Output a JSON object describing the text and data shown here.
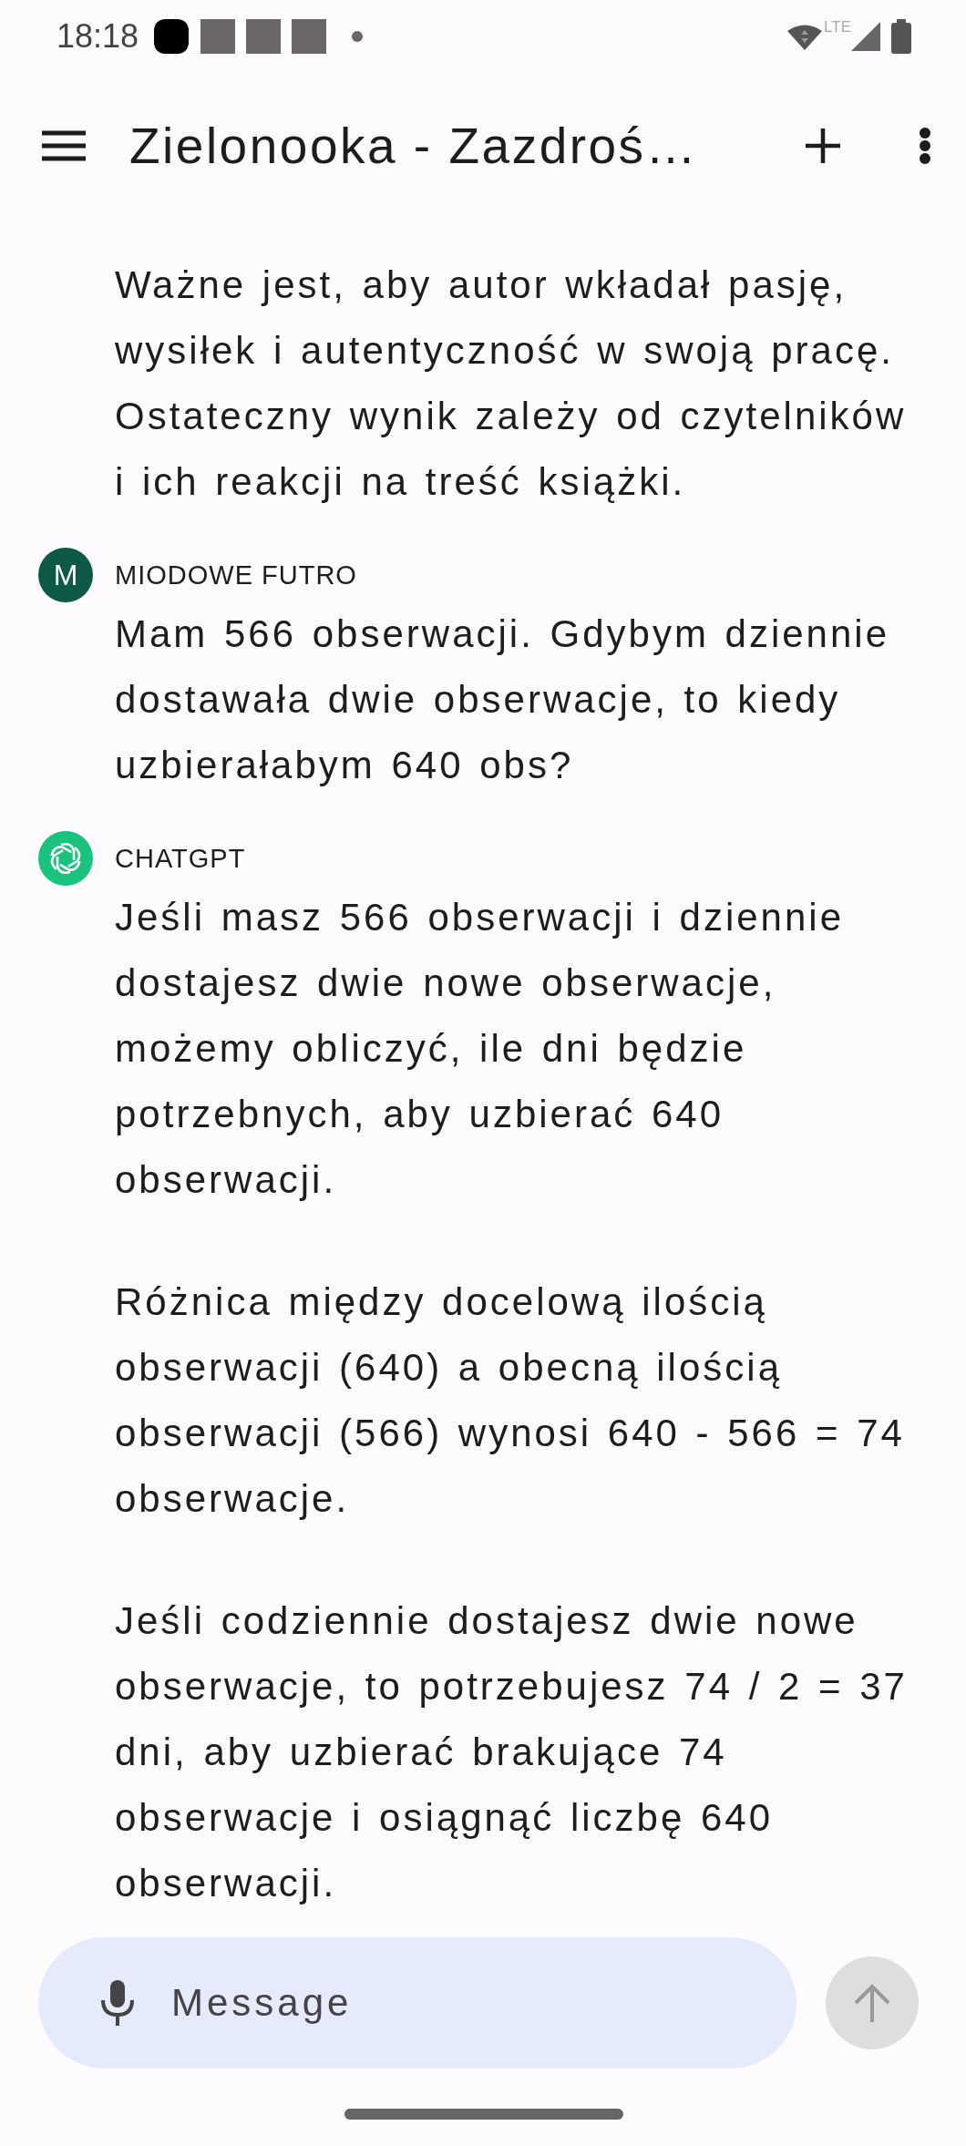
{
  "status_bar": {
    "time": "18:18",
    "network": "LTE"
  },
  "app_bar": {
    "title": "Zielonooka - Zazdroś…"
  },
  "messages": [
    {
      "paragraphs": [
        "Ważne jest, aby autor wkładał pasję, wysiłek i autentyczność w swoją pracę. Ostateczny wynik zależy od czytelników i ich reakcji na treść książki."
      ]
    },
    {
      "sender": "MIODOWE FUTRO",
      "kind": "user",
      "avatar_letter": "M",
      "color": "#0d5846",
      "paragraphs": [
        "Mam 566 obserwacji. Gdybym dziennie dostawała dwie obserwacje, to kiedy uzbierałabym 640 obs?"
      ]
    },
    {
      "sender": "CHATGPT",
      "kind": "assistant",
      "color": "#19c37d",
      "paragraphs": [
        "Jeśli masz 566 obserwacji i dziennie dostajesz dwie nowe obserwacje, możemy obliczyć, ile dni będzie potrzebnych, aby uzbierać 640 obserwacji.",
        "Różnica między docelową ilością obserwacji (640) a obecną ilością obserwacji (566) wynosi 640 - 566 = 74 obserwacje.",
        "Jeśli codziennie dostajesz dwie nowe obserwacje, to potrzebujesz 74 / 2 = 37 dni, aby uzbierać brakujące 74 obserwacje i osiągnąć liczbę 640 obserwacji."
      ]
    }
  ],
  "composer": {
    "placeholder": "Message"
  }
}
